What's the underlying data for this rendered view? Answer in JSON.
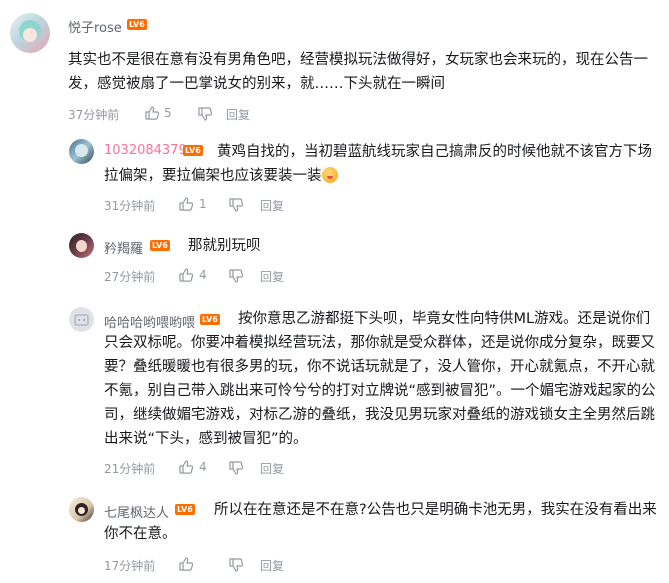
{
  "comments": [
    {
      "username": "悦子rose",
      "level": "LV6",
      "text": "其实也不是很在意有没有男角色吧，经营模拟玩法做得好，女玩家也会来玩的，现在公告一发，感觉被扇了一巴掌说女的别来，就……下头就在一瞬间",
      "time": "37分钟前",
      "likes": "5",
      "reply_label": "回复"
    },
    {
      "username": "1032084379",
      "level": "LV6",
      "text": "黄鸡自找的，当初碧蓝航线玩家自己搞肃反的时候他就不该官方下场拉偏架，要拉偏架也应该要装一装",
      "emoji": "smile-emoji",
      "time": "31分钟前",
      "likes": "1",
      "reply_label": "回复"
    },
    {
      "username": "矜羯羅",
      "level": "LV6",
      "text": "那就别玩呗",
      "time": "27分钟前",
      "likes": "4",
      "reply_label": "回复"
    },
    {
      "username": "哈哈哈哟喂哟喂",
      "level": "LV6",
      "text": "按你意思乙游都挺下头呗，毕竟女性向特供ML游戏。还是说你们只会双标呢。你要冲着模拟经营玩法，那你就是受众群体，还是说你成分复杂，既要又要？叠纸暖暖也有很多男的玩，你不说话玩就是了，没人管你，开心就氪点，不开心就不氪，别自己带入跳出来可怜兮兮的打对立牌说“感到被冒犯”。一个媚宅游戏起家的公司，继续做媚宅游戏，对标乙游的叠纸，我没见男玩家对叠纸的游戏锁女主全男然后跳出来说“下头，感到被冒犯”的。",
      "time": "21分钟前",
      "likes": "4",
      "reply_label": "回复"
    },
    {
      "username": "七尾枫达人",
      "level": "LV6",
      "text": "所以在在意还是不在意?公告也只是明确卡池无男，我实在没有看出来你不在意。",
      "time": "17分钟前",
      "likes": "",
      "reply_label": "回复"
    }
  ],
  "colors": {
    "level_badge": "#ff6c00",
    "username_pink": "#fb7299",
    "meta_gray": "#9499a0"
  }
}
